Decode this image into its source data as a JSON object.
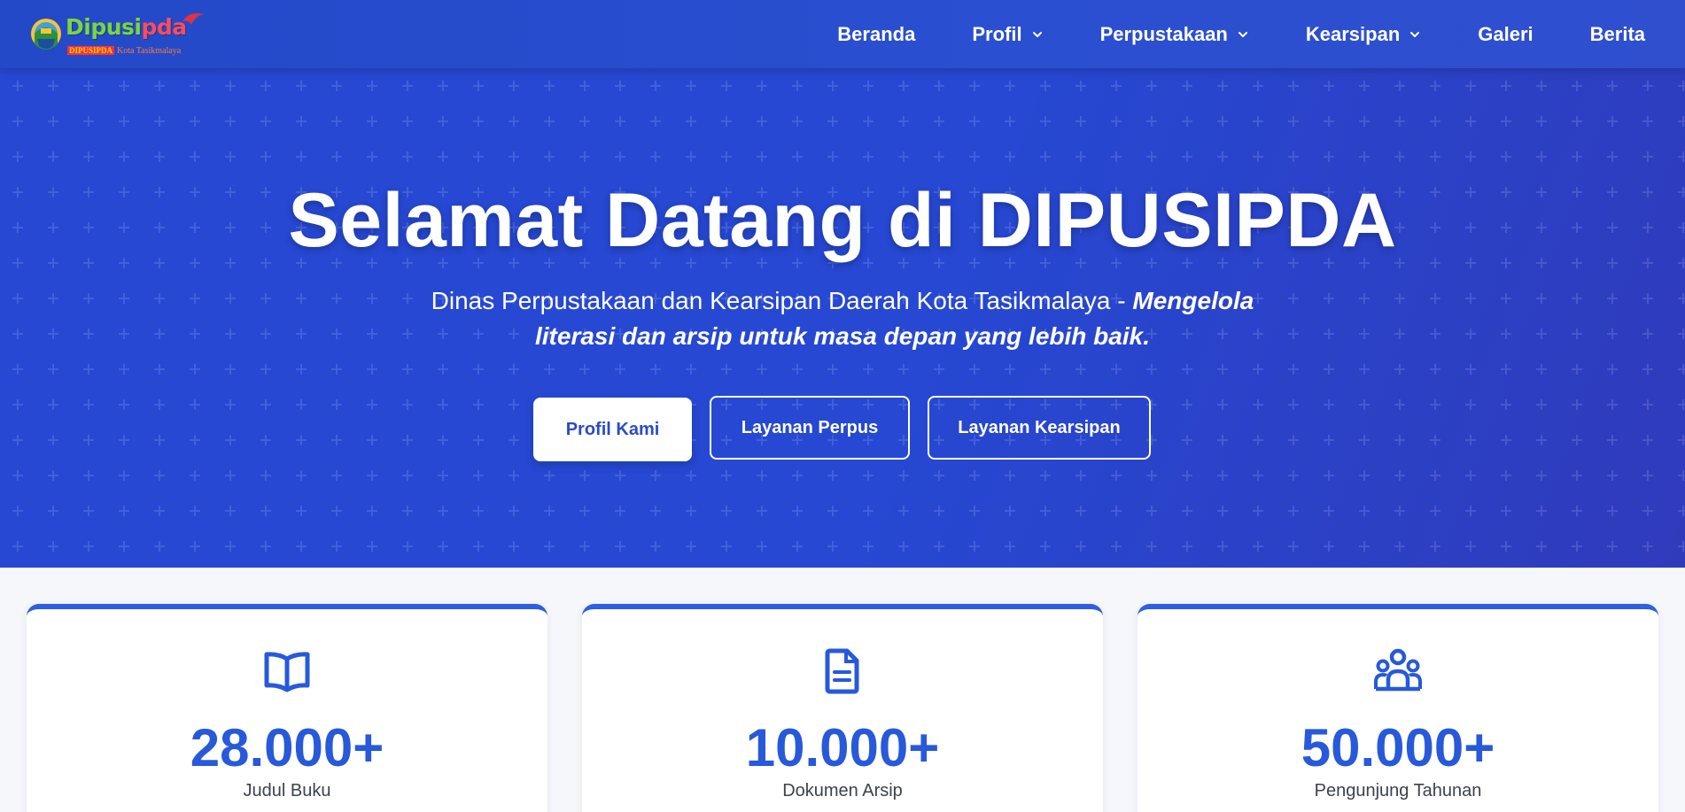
{
  "brand": {
    "name_part1": "Dipusi",
    "name_part2": "pda",
    "tag_cap": "DIPUSIPDA",
    "tag_city": "Kota Tasikmalaya",
    "accent": "#2a4cc4",
    "logo_green": "#7bd63a",
    "logo_red": "#ff4b5c"
  },
  "nav": {
    "items": [
      {
        "label": "Beranda",
        "dropdown": false
      },
      {
        "label": "Profil",
        "dropdown": true
      },
      {
        "label": "Perpustakaan",
        "dropdown": true
      },
      {
        "label": "Kearsipan",
        "dropdown": true
      },
      {
        "label": "Galeri",
        "dropdown": false
      },
      {
        "label": "Berita",
        "dropdown": false
      }
    ],
    "chevron_icon": "chevron-down-icon"
  },
  "hero": {
    "title": "Selamat Datang di DIPUSIPDA",
    "subtitle_plain": "Dinas Perpustakaan dan Kearsipan Daerah Kota Tasikmalaya - ",
    "subtitle_emphasis": "Mengelola literasi dan arsip untuk masa depan yang lebih baik.",
    "buttons": {
      "profil": "Profil Kami",
      "perpus": "Layanan Perpus",
      "arsip": "Layanan Kearsipan"
    },
    "background": "#2648d2"
  },
  "stats": [
    {
      "icon": "book-open-icon",
      "value": "28.000+",
      "label": "Judul Buku"
    },
    {
      "icon": "document-icon",
      "value": "10.000+",
      "label": "Dokumen Arsip"
    },
    {
      "icon": "users-icon",
      "value": "50.000+",
      "label": "Pengunjung Tahunan"
    }
  ]
}
